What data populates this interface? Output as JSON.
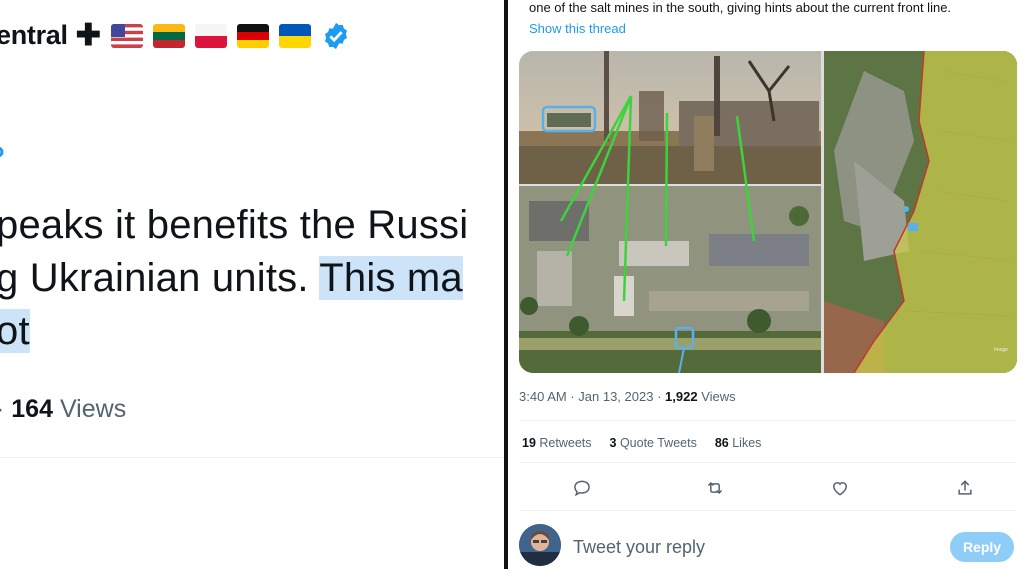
{
  "left_tweet": {
    "display_name": "entral",
    "flags": [
      "flag-united-states-icon",
      "flag-lithuania-icon",
      "flag-poland-icon",
      "flag-germany-icon",
      "flag-ukraine-icon"
    ],
    "body_lines": [
      {
        "text": "peaks it benefits the Russi",
        "highlight": ""
      },
      {
        "text": "g Ukrainian units. ",
        "highlight": "This ma"
      },
      {
        "text": "",
        "highlight": "ot"
      }
    ],
    "views_count": "164",
    "views_label": "Views",
    "separator": "·"
  },
  "right_tweet": {
    "snippet": "one of the salt mines in the south, giving hints about the current front line.",
    "show_thread": "Show this thread",
    "time": "3:40 AM",
    "date": "Jan 13, 2023",
    "views_count": "1,922",
    "views_label": "Views",
    "stats": {
      "retweets_count": "19",
      "retweets_label": "Retweets",
      "quotes_count": "3",
      "quotes_label": "Quote Tweets",
      "likes_count": "86",
      "likes_label": "Likes"
    },
    "map_watermark": "Image",
    "reply_placeholder": "Tweet your reply",
    "reply_button": "Reply"
  },
  "colors": {
    "accent": "#1d9bf0",
    "highlight": "#cde4f8",
    "muted_text": "#536471",
    "reply_button": "#8ecdf8",
    "annotation_green": "#3cd33c"
  }
}
